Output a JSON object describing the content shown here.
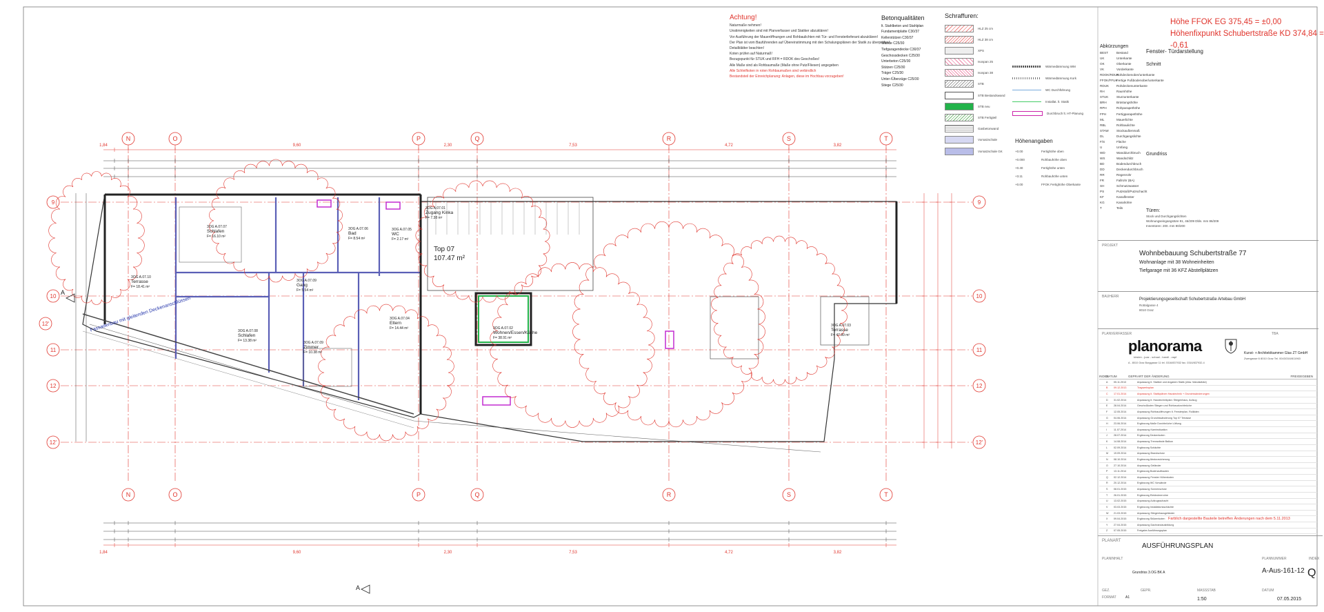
{
  "warning": {
    "title": "Achtung!",
    "lines": [
      "Naturmaße nehmen!",
      "Unstimmigkeiten sind mit Planverfasser und Statiker abzuklären!",
      "Vor Ausführung der Maueröffnungen und Rohbaulichten mit Tür- und Fensterlieferant abzuklären!",
      "Der Plan ist vom Bauführenden auf Übereinstimmung mit den Schalungsplänen der Statik zu überprüfen!",
      "Detailblätter beachten!",
      "Koten prüfen auf Naturmaß!",
      "Bezugspunkt für STUK und RFH = RDOK des Geschoßes!",
      "Alle Maße sind als Rohbaumaße (Maße ohne Putz/Fliesen) angegeben"
    ],
    "red_lines": [
      "Alle Schleifkoten in roten Rohbaumaßen sind verbindlich",
      "Bestandsteil der Einreichplanung: Anlagen, diese im Hochbau vorzugeben!"
    ]
  },
  "beton": {
    "title": "Betonqualitäten",
    "lines": [
      "lt. Stahlbeton und Stahlplan",
      "Fundamentplatte C30/37",
      "Kellerstützen C30/37",
      "Wände C25/30",
      "Tiefgaragendecke C30/37",
      "Geschossdecken C25/30",
      "Unterbeton C25/30",
      "Stützen C25/30",
      "Träger C25/30",
      "Unter-/Überzüge C25/30",
      "Stiege C25/30"
    ]
  },
  "schraffuren": {
    "title": "Schraffuren:",
    "items": [
      "HLZ 25 cm",
      "HLZ 38 cm",
      "XPS",
      "Isospan 25",
      "Isospan 38",
      "STB",
      "STB Bestandswand",
      "STB neu",
      "STB Fertigteil",
      "Gasbetonwand",
      "Vorsatzschale",
      "Vorsatzschale GK"
    ]
  },
  "lines_legend": {
    "items": [
      "Wärmedämmung WM",
      "Wärmedämmung Kork",
      "WC Durchführung",
      "Installat. lt. Statik",
      "Durchbruch lt. HT-Planung"
    ]
  },
  "hoehen": {
    "title": "Höhenangaben",
    "rows": [
      [
        "+0.00",
        "Fertighöhe oben"
      ],
      [
        "+0.000",
        "Rohbauhöhe oben"
      ],
      [
        "+0.40",
        "Fertighöhe unten"
      ],
      [
        "+3.11",
        "Rohbauhöhe unten"
      ],
      [
        "+0.00",
        "FFOK Fertighöhe Oberkante"
      ]
    ]
  },
  "ffok": {
    "line1": "Höhe FFOK EG 375,45 = ±0,00",
    "line2": "Höhenfixpunkt Schubertstraße KD 374,84 = -0,61"
  },
  "abkuerzungen": {
    "title": "Abkürzungen",
    "rows": [
      [
        "BEST",
        "Bestand"
      ],
      [
        "UK",
        "Unterkante"
      ],
      [
        "OK",
        "Oberkante"
      ],
      [
        "VK",
        "Vorderkante"
      ],
      [
        "RDOK/RDUK",
        "Rohdeckenober/unterkante"
      ],
      [
        "FFOK/FFUK",
        "Fertige Fußbodenober/unterkante"
      ],
      [
        "RDUK",
        "Rohdeckenunterkante"
      ],
      [
        "RH",
        "Raumhöhe"
      ],
      [
        "STUK",
        "Sturzunterkante"
      ],
      [
        "BRH",
        "Brüstungshöhe"
      ],
      [
        "RPH",
        "Rohparapethöhe"
      ],
      [
        "FPH",
        "Fertigparapethöhe"
      ],
      [
        "ML",
        "Mauerlichte"
      ],
      [
        "RBL",
        "Rohbaulichte"
      ],
      [
        "STAW",
        "Stockaußenmaß"
      ],
      [
        "DL",
        "Durchgangslichte"
      ],
      [
        "F/S",
        "Fläche"
      ],
      [
        "U",
        "Umfang"
      ],
      [
        "WD",
        "Wanddurchbruch"
      ],
      [
        "WS",
        "Wandschlitz"
      ],
      [
        "BD",
        "Bodendurchbruch"
      ],
      [
        "DD",
        "Deckendurchbruch"
      ],
      [
        "RR",
        "Regenrohr"
      ],
      [
        "FR",
        "Fallrohr (BA)"
      ],
      [
        "SH",
        "Schmutzwasser"
      ],
      [
        "PS",
        "Putzstoß/Putzschacht"
      ],
      [
        "KF",
        "Kanalfenster"
      ],
      [
        "KG",
        "Kanalrohre"
      ],
      [
        "T",
        "Teils"
      ]
    ]
  },
  "fenster": {
    "title": "Fenster- Türdarstellung",
    "schnitt": "Schnitt",
    "grundriss": "Grundriss",
    "tueren": "Türen:",
    "tueren_lines": [
      "Stock und Durchgangslichten",
      "Wohnungseingangstüre 91, 46/209 Dbls. mm 86/209",
      "Innentüren: 200. mm 90/200"
    ]
  },
  "projekt": {
    "label": "PROJEKT",
    "line1": "Wohnbebauung Schubertstraße 77",
    "line2": "Wohnanlage mit 38 Wohneinheiten",
    "line3": "Tiefgarage mit 36 KFZ Abstellplätzen"
  },
  "bauherr": {
    "label": "BAUHERR",
    "name": "Projektierungsgesellschaft Schubertstraße Artebau GmbH",
    "street": "Rottalgasse 4",
    "city": "8010 Graz"
  },
  "planverfasser": {
    "label": "PLANVERFASSER",
    "tba_label": "TBA",
    "logo": "planorama",
    "logo_sub": "kirsten - juaz - schaal - bandl - zapf",
    "kammer": "Kunst- + Architektkammer Glas ZT GmbH",
    "kammer_addr": "Zwergasse 6     8010 Graz     Tel. 0043/316/811963",
    "address": "A - 8010 Graz     Burggasse 11     tel. 0316/837932     fax. 0316/837932-4"
  },
  "index": {
    "headers": [
      "INDEX",
      "DATUM",
      "GEPR",
      "ART DER ÄNDERUNG",
      "FREIGEGEBEN"
    ],
    "rows": [
      [
        "A",
        "05.11.2013",
        "",
        "Anpassung lt. Statiker und Angaben Statik (Abw. Wandstärke)"
      ],
      [
        "B",
        "09.12.2013",
        "",
        "Tragwerksplan"
      ],
      [
        "C",
        "17.01.2014",
        "",
        "Anpassung lt. Statikplänen Haustechnik + Grundrissänderungen"
      ],
      [
        "D",
        "31.02.2014",
        "",
        "Anpassung lt. Haustechnikplan: Stiegenhaus, Aufzug"
      ],
      [
        "E",
        "28.04.2014",
        "",
        "Geschoßkoten Stiegen und Rohbaudurchbrüche"
      ],
      [
        "F",
        "12.05.2014",
        "",
        "Anpassung Rohbauöffnungen lt. Fensterplan, Rolläden"
      ],
      [
        "G",
        "04.06.2014",
        "",
        "Anpassung Grundrissänderung Top 07 Terrasse"
      ],
      [
        "H",
        "23.06.2014",
        "",
        "Ergänzung Maße Durchbrüche Lüftung"
      ],
      [
        "I",
        "11.07.2014",
        "",
        "Anpassung Kaminsituation"
      ],
      [
        "J",
        "28.07.2014",
        "",
        "Ergänzung Deckenkoten"
      ],
      [
        "K",
        "14.08.2014",
        "",
        "Anpassung Trennwände Balkon"
      ],
      [
        "L",
        "02.09.2014",
        "",
        "Ergänzung Schächte"
      ],
      [
        "M",
        "19.09.2014",
        "",
        "Anpassung Brandschutz"
      ],
      [
        "N",
        "08.10.2014",
        "",
        "Ergänzung Absturzsicherung"
      ],
      [
        "O",
        "27.10.2014",
        "",
        "Anpassung Geländer"
      ],
      [
        "P",
        "13.11.2014",
        "",
        "Ergänzung Bodenaufbauten"
      ],
      [
        "Q",
        "02.12.2014",
        "",
        "Anpassung Fenster Höhenkoten"
      ],
      [
        "R",
        "20.12.2014",
        "",
        "Ergänzung WC Vorwände"
      ],
      [
        "S",
        "08.01.2015",
        "",
        "Anpassung Sonnenschutz"
      ],
      [
        "T",
        "26.01.2015",
        "",
        "Ergänzung Elektroleerrohre"
      ],
      [
        "U",
        "13.02.2015",
        "",
        "Anpassung Aufzugsschacht"
      ],
      [
        "V",
        "03.03.2015",
        "",
        "Ergänzung Installationsschächte"
      ],
      [
        "W",
        "21.03.2015",
        "",
        "Anpassung Stiegenhausgeländer"
      ],
      [
        "X",
        "09.04.2015",
        "",
        "Ergänzung Stützenkoten"
      ],
      [
        "Y",
        "27.04.2015",
        "",
        "Anpassung Dachrandausbildung"
      ],
      [
        "Z",
        "07.05.2015",
        "",
        "Freigabe Ausführungsplan"
      ]
    ],
    "note": "Farblich dargestellte Bauteile betreffen Änderungen nach dem 5.11.2013"
  },
  "planblock": {
    "plan_label": "PLANART",
    "plan_value": "AUSFÜHRUNGSPLAN",
    "inhalt_label": "PLANINHALT",
    "inhalt_value": "Grundriss 3.OG BK A",
    "nummer_label": "PLANNUMMER",
    "nummer_value": "A-Aus-161-12",
    "index_label": "INDEX",
    "index_value": "Q",
    "gez_label": "GEZ.",
    "gez_value": "",
    "gepr_label": "GEPR.",
    "gepr_value": "",
    "format_label": "FORMAT",
    "format_value": "A1",
    "massstab_label": "MASSSTAB",
    "massstab_value": "1:50",
    "datum_label": "DATUM",
    "datum_value": "07.05.2015"
  },
  "plan": {
    "axes_top": [
      "N",
      "O",
      "P",
      "Q",
      "R",
      "S",
      "T"
    ],
    "axes_side": [
      "9",
      "10",
      "11",
      "12",
      "12'"
    ],
    "dims_top": [
      "1,84",
      "9,60",
      "2,30",
      "7,53",
      "4,72",
      "3,82"
    ],
    "dims_bottom": [
      "1,84",
      "9,60",
      "2,30",
      "7,53",
      "4,72",
      "3,82"
    ],
    "top": "Top 07",
    "top_area": "107.47 m²",
    "rooms": [
      [
        "3OG A.07.07",
        "Schlafen",
        "F= 16.10 m²"
      ],
      [
        "3OG A.07.06",
        "Bad",
        "F= 8.54 m²"
      ],
      [
        "3OG A.07.05",
        "WC",
        "F= 2.17 m²"
      ],
      [
        "3OG A.07.01",
        "Zugang Kinka",
        "F= 7.38 m²"
      ],
      [
        "3OG A.07.10",
        "Terrasse",
        "F= 18.41 m²"
      ],
      [
        "3OG A.07.09",
        "Gang",
        "F= 5.54 m²"
      ],
      [
        "3OG A.07.08",
        "Schlafen",
        "F= 13.38 m²"
      ],
      [
        "3OG A.07.09",
        "Zimmer",
        "F= 10.38 m²"
      ],
      [
        "3OG A.07.04",
        "Eltern",
        "F= 14.44 m²"
      ],
      [
        "3OG A.07.02",
        "Wohnen/Essen/Küche",
        "F= 38.91 m²"
      ],
      [
        "3OG A.07.03",
        "Terrasse",
        "F= 47.99 m²"
      ]
    ],
    "diagonal_note": "Fassadenbau mit gleitenden Deckenanschlüssen",
    "marker_A": "A"
  },
  "colors": {
    "red": "#e0342c",
    "magenta": "#c22ad0",
    "wall": "#5a5fb6",
    "green": "#22b34a"
  }
}
